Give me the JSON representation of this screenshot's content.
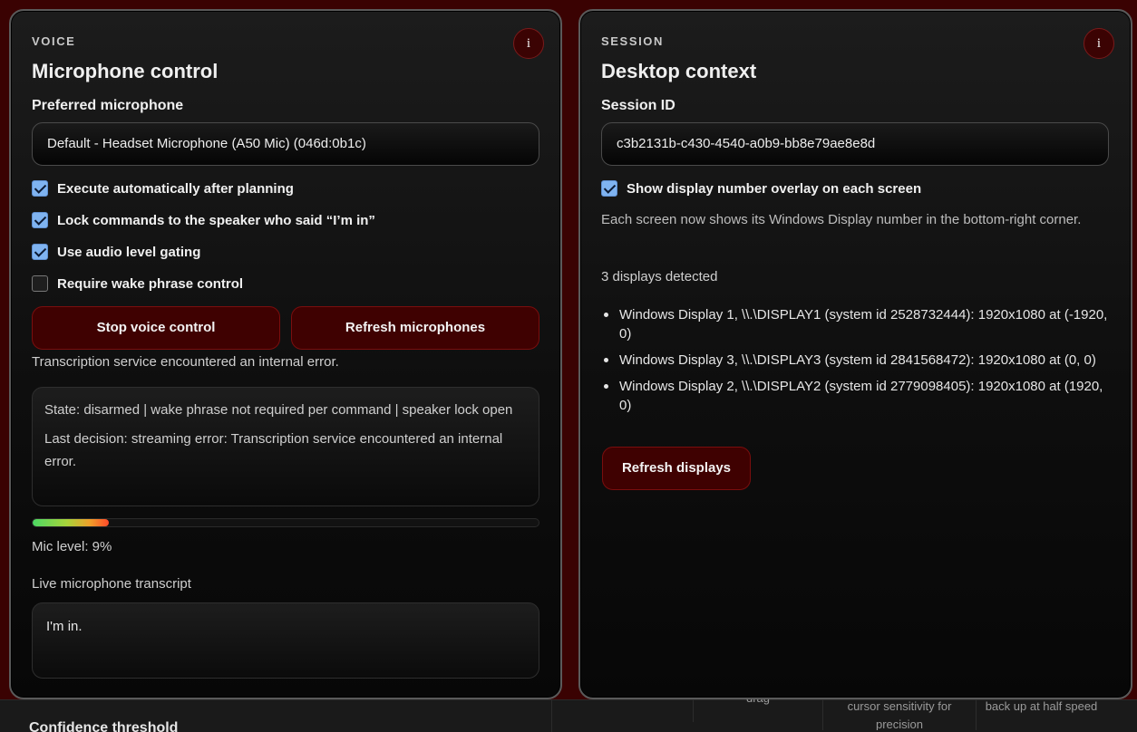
{
  "voice": {
    "eyebrow": "VOICE",
    "info_label": "i",
    "title": "Microphone control",
    "mic_label": "Preferred microphone",
    "mic_value": "Default - Headset Microphone (A50 Mic) (046d:0b1c)",
    "checks": [
      {
        "label": "Execute automatically after planning",
        "checked": true
      },
      {
        "label": "Lock commands to the speaker who said “I’m in”",
        "checked": true
      },
      {
        "label": "Use audio level gating",
        "checked": true
      },
      {
        "label": "Require wake phrase control",
        "checked": false
      }
    ],
    "stop_button": "Stop voice control",
    "refresh_button": "Refresh microphones",
    "error_text": "Transcription service encountered an internal error.",
    "state_line": "State: disarmed | wake phrase not required per command | speaker lock open",
    "last_decision": "Last decision: streaming error: Transcription service encountered an internal error.",
    "mic_level_fraction": 0.15,
    "mic_level_text": "Mic level: 9%",
    "transcript_label": "Live microphone transcript",
    "transcript_text": "I'm in."
  },
  "session": {
    "eyebrow": "SESSION",
    "info_label": "i",
    "title": "Desktop context",
    "session_label": "Session ID",
    "session_value": "c3b2131b-c430-4540-a0b9-bb8e79ae8e8d",
    "overlay_check": {
      "label": "Show display number overlay on each screen",
      "checked": true
    },
    "overlay_desc": "Each screen now shows its Windows Display number in the bottom-right corner.",
    "detected": "3 displays detected",
    "displays": [
      "Windows Display 1, \\\\.\\DISPLAY1 (system id 2528732444): 1920x1080 at (-1920, 0)",
      "Windows Display 3, \\\\.\\DISPLAY3 (system id 2841568472): 1920x1080 at (0, 0)",
      "Windows Display 2, \\\\.\\DISPLAY2 (system id 2779098405): 1920x1080 at (1920, 0)"
    ],
    "refresh_button": "Refresh displays"
  },
  "background": {
    "confidence_label": "Confidence threshold",
    "cells": [
      "drag",
      "cursor sensitivity for precision",
      "back up at half speed"
    ]
  },
  "colors": {
    "accent": "#3f0101",
    "check": "#7fb3f0",
    "background": "#3a0202"
  }
}
